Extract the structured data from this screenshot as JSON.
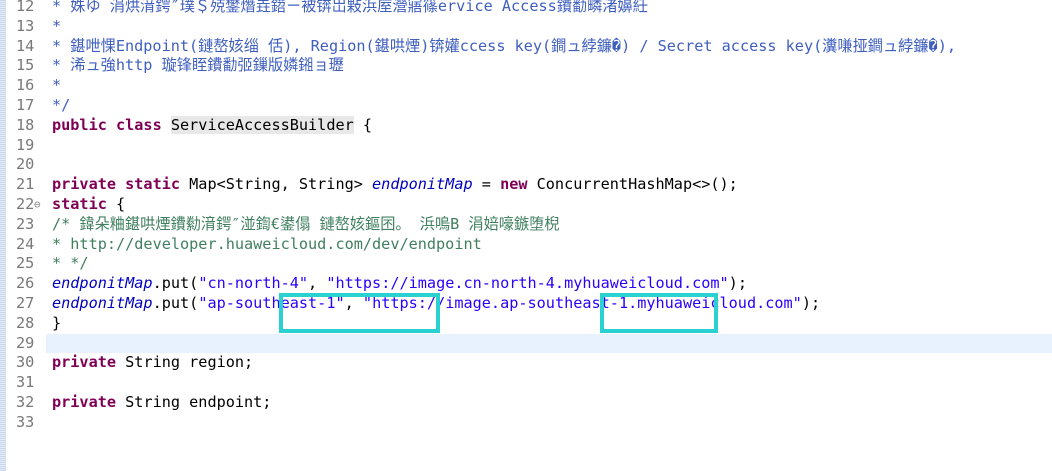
{
  "lines": [
    {
      "n": "12",
      "parts": [
        [
          "jd",
          " * 姝ゆ  涓烘湇鍔″璞＄殑鐢熸垚鍣ㄧ被锛岀敤浜庢瀯寤篠ervice Access鐨勫疄渚嬶紝"
        ]
      ]
    },
    {
      "n": "13",
      "parts": [
        [
          "jd",
          " *"
        ]
      ]
    },
    {
      "n": "14",
      "parts": [
        [
          "jd",
          " * 鍖呭惈Endpoint(鏈嶅姟缁  佸), Region(鍖哄煙)锛孉ccess key(鐧ュ綍鐮�) / Secret access key(瀵嗛挜鐧ュ綍鐮�),"
        ]
      ]
    },
    {
      "n": "15",
      "parts": [
        [
          "jd",
          " * 浠ュ強http 璇锋眰鐨勫弬鏁版嫾鎺ョ瓑"
        ]
      ]
    },
    {
      "n": "16",
      "parts": [
        [
          "jd",
          " *"
        ]
      ]
    },
    {
      "n": "17",
      "parts": [
        [
          "jd",
          " */"
        ]
      ]
    },
    {
      "n": "18",
      "parts": [
        [
          "kw",
          "public class "
        ],
        [
          "hlc",
          "ServiceAccessBuilder"
        ],
        [
          "pl",
          " {"
        ]
      ]
    },
    {
      "n": "19",
      "parts": []
    },
    {
      "n": "20",
      "parts": []
    },
    {
      "n": "21",
      "parts": [
        [
          "pl",
          "    "
        ],
        [
          "kw",
          "private static "
        ],
        [
          "pl",
          "Map<String, String> "
        ],
        [
          "fld",
          "endponitMap"
        ],
        [
          "pl",
          " = "
        ],
        [
          "kw",
          "new "
        ],
        [
          "pl",
          "ConcurrentHashMap<>();"
        ]
      ]
    },
    {
      "n": "22",
      "fold": "⊖",
      "parts": [
        [
          "pl",
          "    "
        ],
        [
          "kw",
          "static"
        ],
        [
          "pl",
          " {"
        ]
      ]
    },
    {
      "n": "23",
      "parts": [
        [
          "cm",
          "        /*  鍏朵粬鍖哄煙鐨勬湇鍔″湴鍧€鍙傝  鏈嶅姟鏂囨。  浜嗚В  涓婄嚎鏃堕棿"
        ]
      ]
    },
    {
      "n": "24",
      "parts": [
        [
          "cm",
          "         *  http://developer.huaweicloud.com/dev/endpoint"
        ]
      ]
    },
    {
      "n": "25",
      "parts": [
        [
          "cm",
          "         * */"
        ]
      ]
    },
    {
      "n": "26",
      "parts": [
        [
          "pl",
          "        "
        ],
        [
          "fld",
          "endponitMap"
        ],
        [
          "pl",
          ".put("
        ],
        [
          "str",
          "\"cn-north-4\""
        ],
        [
          "pl",
          ", "
        ],
        [
          "str",
          "\"https://image.cn-north-4.myhuaweicloud.com\""
        ],
        [
          "pl",
          ");"
        ]
      ]
    },
    {
      "n": "27",
      "parts": [
        [
          "pl",
          "        "
        ],
        [
          "fld",
          "endponitMap"
        ],
        [
          "pl",
          ".put("
        ],
        [
          "str",
          "\"ap-southeast-1\""
        ],
        [
          "pl",
          ", "
        ],
        [
          "str",
          "\"https://image.ap-southeast-1.myhuaweicloud.com\""
        ],
        [
          "pl",
          ");"
        ]
      ]
    },
    {
      "n": "28",
      "parts": [
        [
          "pl",
          "    }"
        ]
      ]
    },
    {
      "n": "29",
      "current": true,
      "parts": []
    },
    {
      "n": "30",
      "parts": [
        [
          "pl",
          "    "
        ],
        [
          "kw",
          "private "
        ],
        [
          "pl",
          "String region;"
        ]
      ]
    },
    {
      "n": "31",
      "parts": []
    },
    {
      "n": "32",
      "parts": [
        [
          "pl",
          "    "
        ],
        [
          "kw",
          "private "
        ],
        [
          "pl",
          "String endpoint;"
        ]
      ]
    },
    {
      "n": "33",
      "parts": []
    }
  ],
  "highlight_color": "#2bd0d0"
}
